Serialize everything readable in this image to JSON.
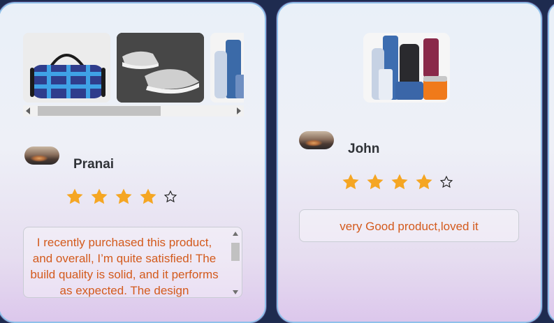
{
  "reviews": [
    {
      "reviewer": "Pranai",
      "rating": 4,
      "rating_max": 5,
      "images": [
        "duffel-bag-image",
        "sneakers-image",
        "cosmetics-bottles-image"
      ],
      "text": "I recently purchased this product, and overall, I’m quite satisfied! The build quality is solid, and it performs as expected. The design"
    },
    {
      "reviewer": "John",
      "rating": 4,
      "rating_max": 5,
      "images": [
        "cosmetics-bottles-image"
      ],
      "text": "very Good product,loved it"
    }
  ],
  "colors": {
    "star_filled": "#f5a623",
    "review_text": "#d35a1c",
    "name_text": "#2f3237",
    "card_border": "#8fc0ea"
  }
}
